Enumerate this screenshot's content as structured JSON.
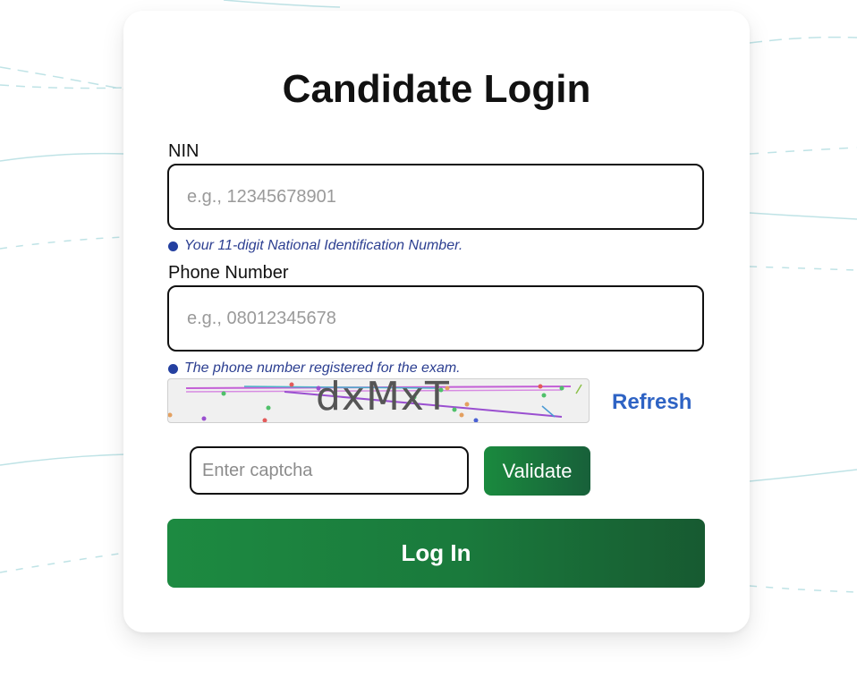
{
  "login": {
    "title": "Candidate Login",
    "nin": {
      "label": "NIN",
      "placeholder": "e.g., 12345678901",
      "value": "",
      "hint": "Your 11-digit National Identification Number."
    },
    "phone": {
      "label": "Phone Number",
      "placeholder": "e.g., 08012345678",
      "value": "",
      "hint": "The phone number registered for the exam."
    },
    "captcha": {
      "text": "dxMxT",
      "refresh_label": "Refresh",
      "input_placeholder": "Enter captcha",
      "validate_label": "Validate"
    },
    "submit_label": "Log In"
  },
  "colors": {
    "primary_green": "#1a7a3c",
    "link_blue": "#2e63c4",
    "hint_blue": "#2c3f91"
  }
}
